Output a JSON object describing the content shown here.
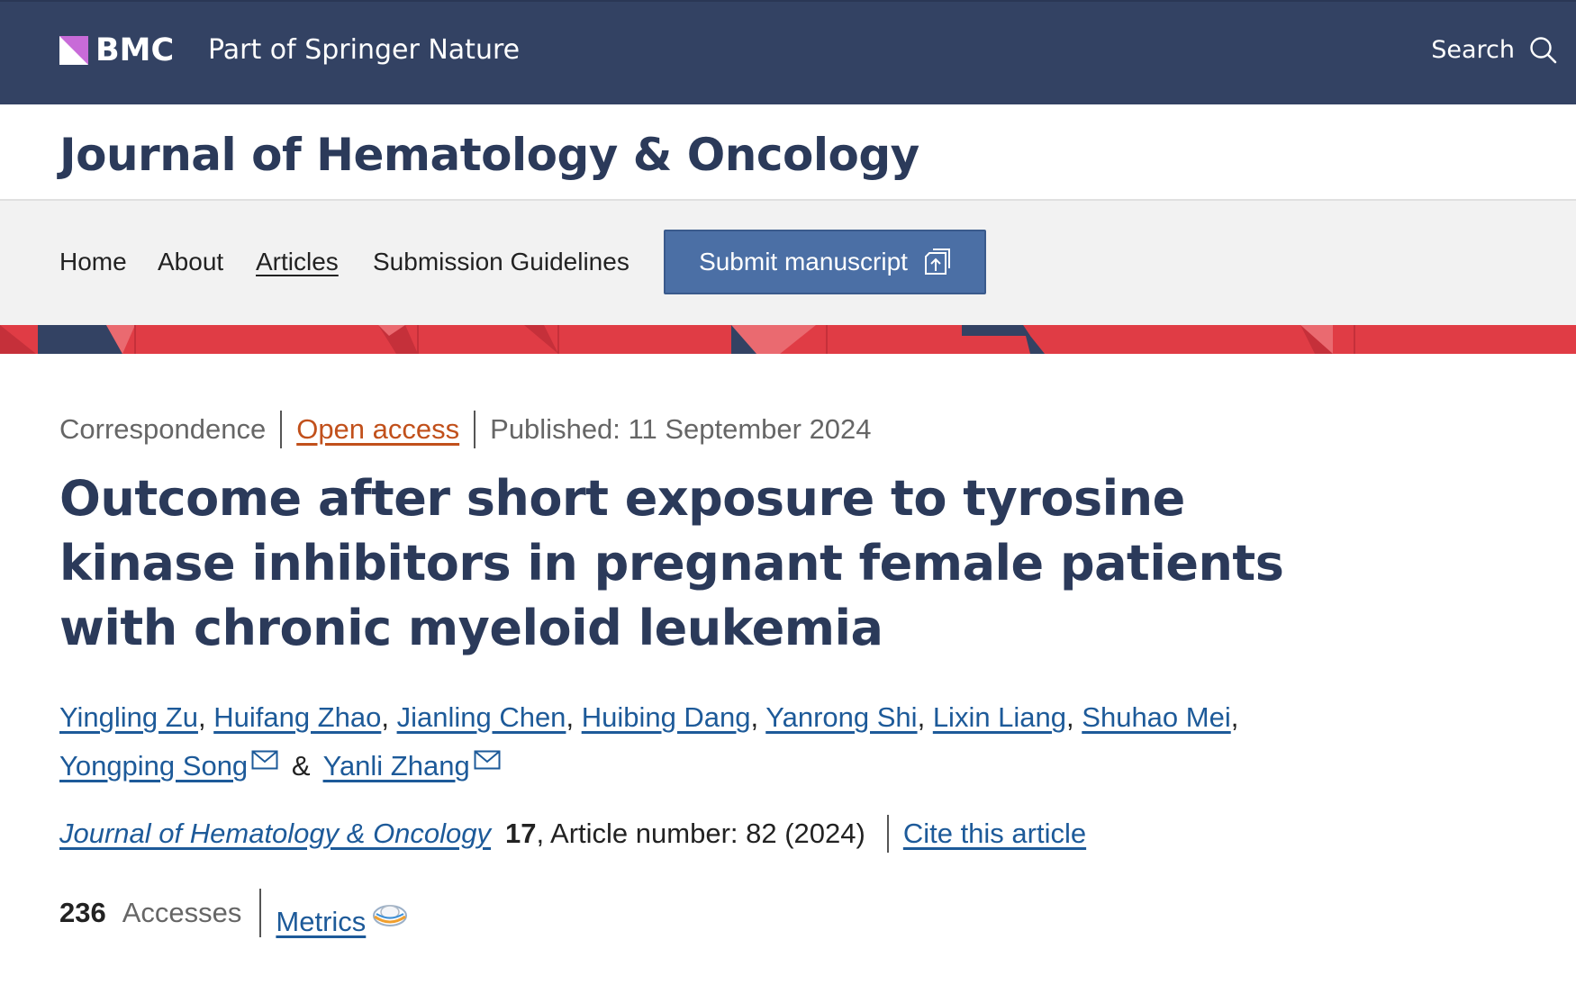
{
  "header": {
    "brand": "BMC",
    "tagline": "Part of Springer Nature",
    "search_label": "Search"
  },
  "journal": {
    "title": "Journal of Hematology & Oncology"
  },
  "nav": {
    "items": [
      {
        "label": "Home"
      },
      {
        "label": "About"
      },
      {
        "label": "Articles"
      },
      {
        "label": "Submission Guidelines"
      }
    ],
    "submit_label": "Submit manuscript"
  },
  "article": {
    "type": "Correspondence",
    "access": "Open access",
    "published": "Published: 11 September 2024",
    "title": "Outcome after short exposure to tyrosine kinase inhibitors in pregnant female patients with chronic myeloid leukemia",
    "authors": [
      "Yingling Zu",
      "Huifang Zhao",
      "Jianling Chen",
      "Huibing Dang",
      "Yanrong Shi",
      "Lixin Liang",
      "Shuhao Mei",
      "Yongping Song",
      "Yanli Zhang"
    ],
    "author_sep": ",",
    "author_and": "&",
    "citation": {
      "journal": "Journal of Hematology & Oncology",
      "volume": "17",
      "details": ", Article number: 82 (2024)",
      "cite_label": "Cite this article"
    },
    "metrics": {
      "accesses_count": "236",
      "accesses_label": "Accesses",
      "metrics_label": "Metrics"
    }
  },
  "colors": {
    "header_bg": "#334263",
    "title_color": "#2b3a5a",
    "link_color": "#1d5a99",
    "open_access": "#c1501b",
    "submit_bg": "#4b6fa5",
    "stripe_red": "#e03c45",
    "brand_purple": "#c86bd8"
  },
  "icons": [
    "bmc-logo-icon",
    "search-icon",
    "submit-manuscript-icon",
    "mail-icon",
    "altmetric-icon"
  ]
}
